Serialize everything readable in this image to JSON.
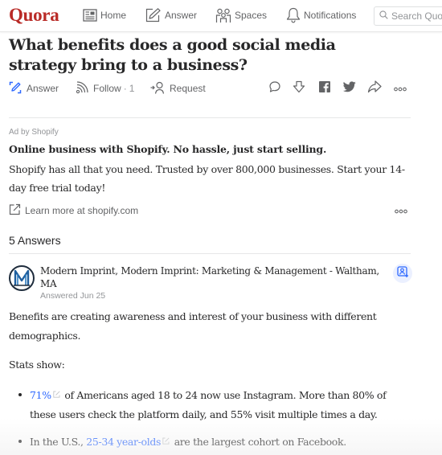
{
  "header": {
    "logo": "Quora",
    "nav": [
      {
        "label": "Home",
        "icon": "home-feed-icon"
      },
      {
        "label": "Answer",
        "icon": "pencil-square-icon"
      },
      {
        "label": "Spaces",
        "icon": "people-group-icon"
      },
      {
        "label": "Notifications",
        "icon": "bell-icon"
      }
    ],
    "search": {
      "placeholder": "Search Quora",
      "icon": "search-icon"
    }
  },
  "question": {
    "title": "What benefits does a good social media strategy bring to a business?",
    "actions": {
      "answer_label": "Answer",
      "follow_label": "Follow",
      "follow_separator": "·",
      "follow_count": "1",
      "request_label": "Request"
    },
    "icon_actions": [
      "comment-icon",
      "downvote-icon",
      "facebook-icon",
      "twitter-icon",
      "share-icon",
      "more-icon"
    ]
  },
  "ad": {
    "label": "Ad by Shopify",
    "title": "Online business with Shopify. No hassle, just start selling.",
    "body": "Shopify has all that you need. Trusted by over 800,000 businesses. Start your 14-day free trial today!",
    "link_label": "Learn more at shopify.com"
  },
  "answers": {
    "count_label": "5 Answers",
    "items": [
      {
        "author": "Modern Imprint, Modern Imprint: Marketing & Management - Waltham, MA",
        "avatar_letter": "M",
        "date": "Answered Jun 25",
        "paragraphs": [
          "Benefits are creating awareness and interest of your business with different demographics.",
          "Stats show:"
        ],
        "bullets": [
          {
            "pre": "",
            "link": "71%",
            "post": " of Americans aged 18 to 24 now use Instagram. More than 80% of these users check the platform daily, and 55% visit multiple times a day."
          },
          {
            "pre": "In the U.S., ",
            "link": "25-34 year-olds",
            "post": " are the largest cohort on Facebook."
          }
        ]
      }
    ]
  },
  "colors": {
    "brand": "#b92b27",
    "link": "#2e69ff",
    "text": "#282829",
    "muted": "#636466"
  }
}
